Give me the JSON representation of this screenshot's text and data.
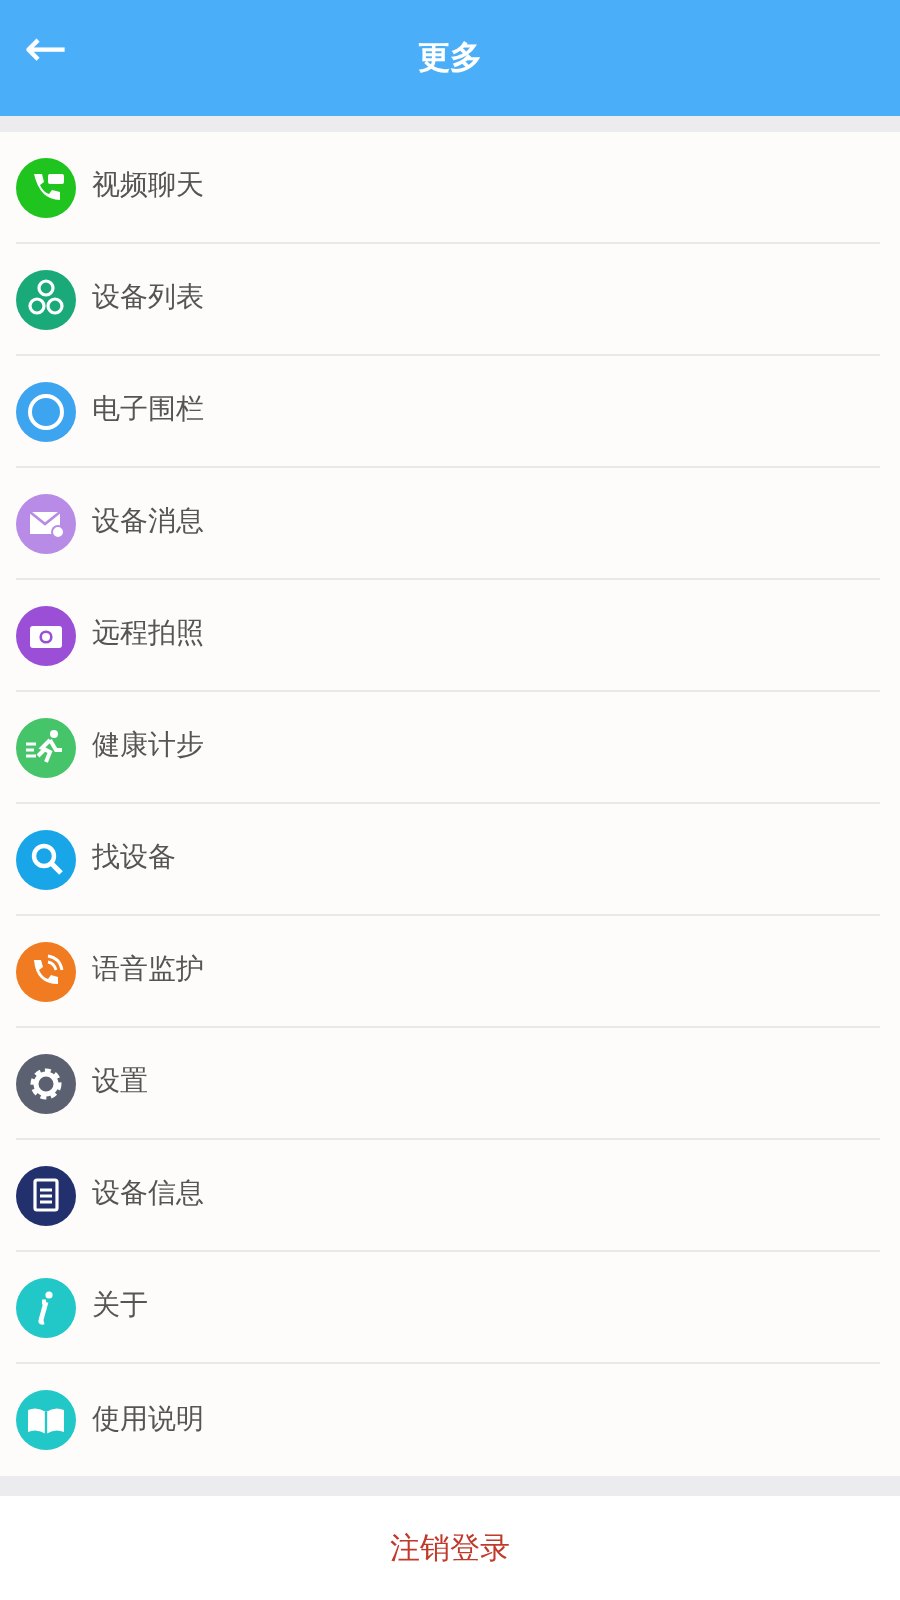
{
  "header": {
    "back": "←",
    "title": "更多"
  },
  "items": [
    {
      "kind": "video",
      "label": "视频聊天"
    },
    {
      "kind": "devices",
      "label": "设备列表"
    },
    {
      "kind": "fence",
      "label": "电子围栏"
    },
    {
      "kind": "message",
      "label": "设备消息"
    },
    {
      "kind": "camera",
      "label": "远程拍照"
    },
    {
      "kind": "steps",
      "label": "健康计步"
    },
    {
      "kind": "search",
      "label": "找设备"
    },
    {
      "kind": "voice",
      "label": "语音监护"
    },
    {
      "kind": "settings",
      "label": "设置"
    },
    {
      "kind": "document",
      "label": "设备信息"
    },
    {
      "kind": "about",
      "label": "关于"
    },
    {
      "kind": "manual",
      "label": "使用说明"
    }
  ],
  "logout": "注销登录"
}
